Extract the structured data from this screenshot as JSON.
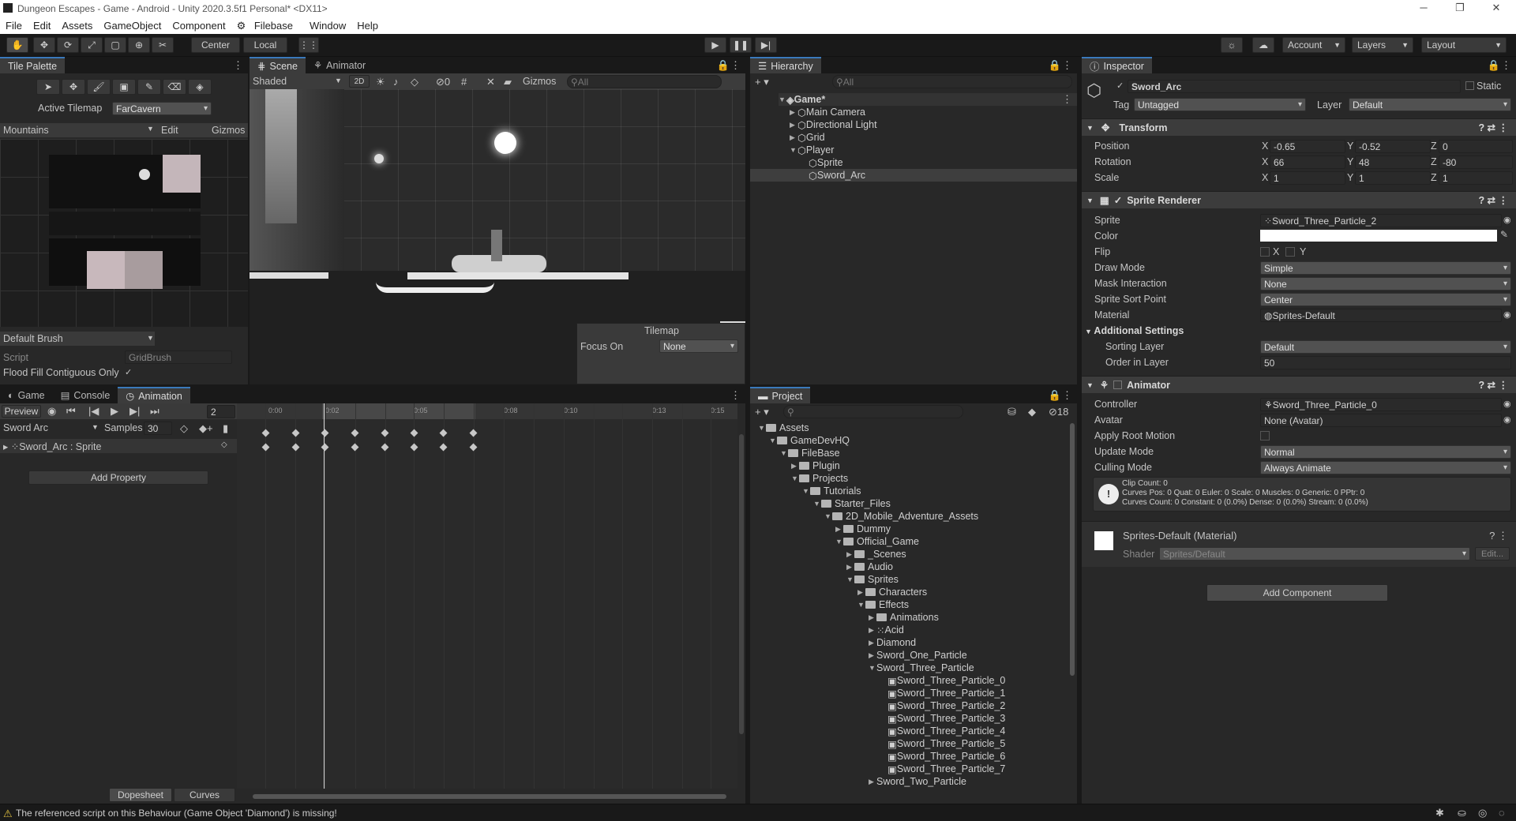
{
  "window": {
    "title": "Dungeon Escapes - Game - Android - Unity 2020.3.5f1 Personal* <DX11>",
    "minimize": "─",
    "maximize": "❐",
    "close": "✕"
  },
  "menu": [
    "File",
    "Edit",
    "Assets",
    "GameObject",
    "Component",
    "Filebase",
    "Window",
    "Help"
  ],
  "toolbar": {
    "pivot_center": "Center",
    "pivot_local": "Local",
    "account": "Account",
    "layers": "Layers",
    "layout": "Layout"
  },
  "tile_palette": {
    "tab": "Tile Palette",
    "active_tilemap_label": "Active Tilemap",
    "active_tilemap_value": "FarCavern",
    "palette": "Mountains",
    "edit": "Edit",
    "gizmos": "Gizmos",
    "brush": "Default Brush",
    "script_label": "Script",
    "script_value": "GridBrush",
    "flood_fill": "Flood Fill Contiguous Only"
  },
  "scene": {
    "tabs": [
      "Scene",
      "Animator"
    ],
    "shading": "Shaded",
    "mode_2d": "2D",
    "gizmos": "Gizmos",
    "search_placeholder": "All",
    "hidden_count": "0",
    "overlay_title": "Tilemap",
    "focus_on_label": "Focus On",
    "focus_on_value": "None"
  },
  "hierarchy": {
    "tab": "Hierarchy",
    "search_placeholder": "All",
    "items": [
      {
        "label": "Game*",
        "depth": 0,
        "arrow": "▼"
      },
      {
        "label": "Main Camera",
        "depth": 1,
        "arrow": "▶"
      },
      {
        "label": "Directional Light",
        "depth": 1,
        "arrow": "▶"
      },
      {
        "label": "Grid",
        "depth": 1,
        "arrow": "▶"
      },
      {
        "label": "Player",
        "depth": 1,
        "arrow": "▼"
      },
      {
        "label": "Sprite",
        "depth": 2,
        "arrow": ""
      },
      {
        "label": "Sword_Arc",
        "depth": 2,
        "arrow": ""
      }
    ]
  },
  "inspector": {
    "tab": "Inspector",
    "object_name": "Sword_Arc",
    "static": "Static",
    "tag_label": "Tag",
    "tag_value": "Untagged",
    "layer_label": "Layer",
    "layer_value": "Default",
    "transform": {
      "title": "Transform",
      "position_label": "Position",
      "px": "-0.65",
      "py": "-0.52",
      "pz": "0",
      "rotation_label": "Rotation",
      "rx": "66",
      "ry": "48",
      "rz": "-80",
      "scale_label": "Scale",
      "sx": "1",
      "sy": "1",
      "sz": "1"
    },
    "sprite_renderer": {
      "title": "Sprite Renderer",
      "sprite_label": "Sprite",
      "sprite_value": "Sword_Three_Particle_2",
      "color_label": "Color",
      "flip_label": "Flip",
      "flip_x": "X",
      "flip_y": "Y",
      "draw_mode_label": "Draw Mode",
      "draw_mode_value": "Simple",
      "mask_label": "Mask Interaction",
      "mask_value": "None",
      "sort_point_label": "Sprite Sort Point",
      "sort_point_value": "Center",
      "material_label": "Material",
      "material_value": "Sprites-Default",
      "additional": "Additional Settings",
      "sorting_layer_label": "Sorting Layer",
      "sorting_layer_value": "Default",
      "order_label": "Order in Layer",
      "order_value": "50"
    },
    "animator": {
      "title": "Animator",
      "controller_label": "Controller",
      "controller_value": "Sword_Three_Particle_0",
      "avatar_label": "Avatar",
      "avatar_value": "None (Avatar)",
      "root_motion_label": "Apply Root Motion",
      "update_label": "Update Mode",
      "update_value": "Normal",
      "culling_label": "Culling Mode",
      "culling_value": "Always Animate",
      "info1": "Clip Count: 0",
      "info2": "Curves Pos: 0 Quat: 0 Euler: 0 Scale: 0 Muscles: 0 Generic: 0 PPtr: 0",
      "info3": "Curves Count: 0 Constant: 0 (0.0%) Dense: 0 (0.0%) Stream: 0 (0.0%)"
    },
    "material": {
      "title": "Sprites-Default (Material)",
      "shader_label": "Shader",
      "shader_value": "Sprites/Default",
      "edit": "Edit..."
    },
    "add_component": "Add Component"
  },
  "animation": {
    "tabs": [
      "Game",
      "Console",
      "Animation"
    ],
    "preview": "Preview",
    "frame": "2",
    "clip": "Sword Arc",
    "samples_label": "Samples",
    "samples_value": "30",
    "property": "Sword_Arc : Sprite",
    "add_property": "Add Property",
    "time_labels": [
      "0:00",
      "0:02",
      "0:05",
      "0:08",
      "0:10",
      "0:13",
      "0:15"
    ],
    "dopesheet": "Dopesheet",
    "curves": "Curves"
  },
  "project": {
    "tab": "Project",
    "hidden_count": "18",
    "tree": [
      {
        "label": "Assets",
        "depth": 0,
        "arrow": "▼",
        "kind": "folder"
      },
      {
        "label": "GameDevHQ",
        "depth": 1,
        "arrow": "▼",
        "kind": "folder"
      },
      {
        "label": "FileBase",
        "depth": 2,
        "arrow": "▼",
        "kind": "folder"
      },
      {
        "label": "Plugin",
        "depth": 3,
        "arrow": "▶",
        "kind": "folder"
      },
      {
        "label": "Projects",
        "depth": 3,
        "arrow": "▼",
        "kind": "folder"
      },
      {
        "label": "Tutorials",
        "depth": 4,
        "arrow": "▼",
        "kind": "folder"
      },
      {
        "label": "Starter_Files",
        "depth": 5,
        "arrow": "▼",
        "kind": "folder"
      },
      {
        "label": "2D_Mobile_Adventure_Assets",
        "depth": 6,
        "arrow": "▼",
        "kind": "folder"
      },
      {
        "label": "Dummy",
        "depth": 7,
        "arrow": "▶",
        "kind": "folder"
      },
      {
        "label": "Official_Game",
        "depth": 7,
        "arrow": "▼",
        "kind": "folder"
      },
      {
        "label": "_Scenes",
        "depth": 8,
        "arrow": "▶",
        "kind": "folder"
      },
      {
        "label": "Audio",
        "depth": 8,
        "arrow": "▶",
        "kind": "folder"
      },
      {
        "label": "Sprites",
        "depth": 8,
        "arrow": "▼",
        "kind": "folder"
      },
      {
        "label": "Characters",
        "depth": 9,
        "arrow": "▶",
        "kind": "folder"
      },
      {
        "label": "Effects",
        "depth": 9,
        "arrow": "▼",
        "kind": "folder"
      },
      {
        "label": "Animations",
        "depth": 10,
        "arrow": "▶",
        "kind": "folder"
      },
      {
        "label": "Acid",
        "depth": 10,
        "arrow": "▶",
        "kind": "asset"
      },
      {
        "label": "Diamond",
        "depth": 10,
        "arrow": "▶",
        "kind": "none"
      },
      {
        "label": "Sword_One_Particle",
        "depth": 10,
        "arrow": "▶",
        "kind": "none"
      },
      {
        "label": "Sword_Three_Particle",
        "depth": 10,
        "arrow": "▼",
        "kind": "none"
      },
      {
        "label": "Sword_Three_Particle_0",
        "depth": 11,
        "arrow": "",
        "kind": "anim"
      },
      {
        "label": "Sword_Three_Particle_1",
        "depth": 11,
        "arrow": "",
        "kind": "anim"
      },
      {
        "label": "Sword_Three_Particle_2",
        "depth": 11,
        "arrow": "",
        "kind": "anim"
      },
      {
        "label": "Sword_Three_Particle_3",
        "depth": 11,
        "arrow": "",
        "kind": "anim"
      },
      {
        "label": "Sword_Three_Particle_4",
        "depth": 11,
        "arrow": "",
        "kind": "anim"
      },
      {
        "label": "Sword_Three_Particle_5",
        "depth": 11,
        "arrow": "",
        "kind": "anim"
      },
      {
        "label": "Sword_Three_Particle_6",
        "depth": 11,
        "arrow": "",
        "kind": "anim"
      },
      {
        "label": "Sword_Three_Particle_7",
        "depth": 11,
        "arrow": "",
        "kind": "anim"
      },
      {
        "label": "Sword_Two_Particle",
        "depth": 10,
        "arrow": "▶",
        "kind": "none"
      }
    ]
  },
  "status": {
    "message": "The referenced script on this Behaviour (Game Object 'Diamond') is missing!"
  },
  "colors": {
    "accent": "#3a79bb",
    "selection": "#2c5d87",
    "panel": "#282828",
    "header": "#3c3c3c"
  }
}
